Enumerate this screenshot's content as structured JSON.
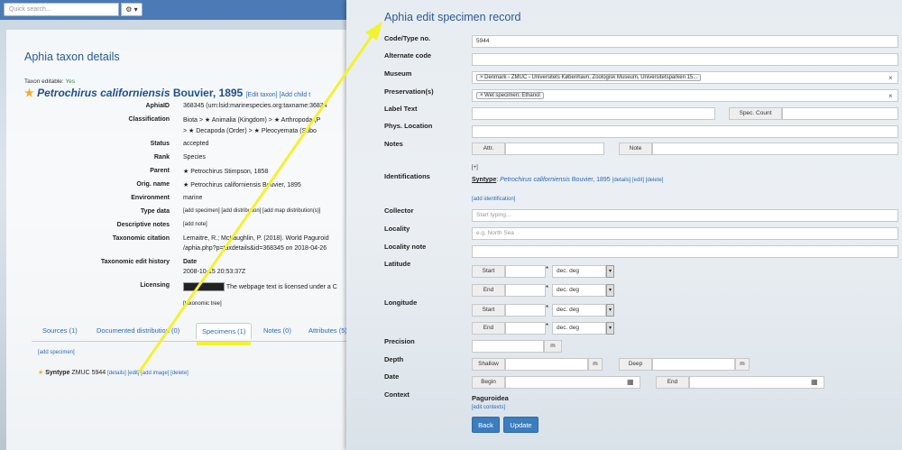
{
  "left": {
    "search_placeholder": "Quick search...",
    "gear": "⚙ ▾",
    "title": "Aphia taxon details",
    "editable_label": "Taxon editable:",
    "editable_value": "Yes",
    "taxon_name": "Petrochirus californiensis",
    "taxon_author": "Bouvier, 1895",
    "taxon_actions": "[Edit taxon] [Add child t",
    "rows": {
      "aphiaid_k": "AphiaID",
      "aphiaid_v": "368345  (urn:lsid:marinespecies.org:taxname:36834",
      "class_k": "Classification",
      "class_v1": "Biota  >  ★ Animalia (Kingdom)  >  ★ Arthropoda (P",
      "class_v2": ">  ★ Decapoda (Order)  >  ★ Pleocyemata (Subo",
      "status_k": "Status",
      "status_v": "accepted",
      "rank_k": "Rank",
      "rank_v": "Species",
      "parent_k": "Parent",
      "parent_v": "★ Petrochirus Stimpson, 1858",
      "orig_k": "Orig. name",
      "orig_v": "★ Petrochirus californiensis Bouvier, 1895",
      "env_k": "Environment",
      "env_v": "marine",
      "type_k": "Type data",
      "type_v": "[add specimen] [add distribution] [add map distribution(s)]",
      "desc_k": "Descriptive notes",
      "desc_v": "[add note]",
      "cit_k": "Taxonomic citation",
      "cit_v1": "Lemaitre, R.; McLaughlin, P. (2018). World Paguroid",
      "cit_v2": "/aphia.php?p=taxdetails&id=368345 on 2018-04-26",
      "hist_k": "Taxonomic edit history",
      "hist_v": "Date",
      "hist_date": "2008-10-15 20:53:37Z",
      "lic_k": "Licensing",
      "lic_v": "The webpage text is licensed under a C",
      "tree": "[taxonomic tree]"
    },
    "tabs": [
      "Sources (1)",
      "Documented distribution (0)",
      "Specimens (1)",
      "Notes (0)",
      "Attributes (5)"
    ],
    "add_specimen": "[add specimen]",
    "syntype_label": "Syntype",
    "syntype_text": "ZMUC 5944",
    "syntype_links": "[details] [edit] [add image] [delete]"
  },
  "modal": {
    "title": "Aphia edit specimen record",
    "labels": {
      "code": "Code/Type no.",
      "alt": "Alternate code",
      "museum": "Museum",
      "pres": "Preservation(s)",
      "label_text": "Label Text",
      "phys": "Phys. Location",
      "notes": "Notes",
      "ident": "Identifications",
      "collector": "Collector",
      "locality": "Locality",
      "locality_note": "Locality note",
      "latitude": "Latitude",
      "longitude": "Longitude",
      "precision": "Precision",
      "depth": "Depth",
      "date": "Date",
      "context": "Context"
    },
    "code_value": "5944",
    "museum_value": "× Denmark - ZMUC - Universitets København, Zoologisk Museum, Universitetsparken 15...",
    "pres_value": "× Wet specimen: Ethanol",
    "clear_x": "×",
    "spec_count": "Spec. Count",
    "attr": "Attr.",
    "note": "Note",
    "toggle": "[+]",
    "ident_type": "Syntype",
    "ident_name": "Petrochirus californiensis",
    "ident_author": "Bouvier, 1895",
    "ident_links": "[details] [edit] [delete]",
    "add_ident": "[add identification]",
    "collector_ph": "Start typing...",
    "locality_ph": "e.g. North Sea",
    "start": "Start",
    "end": "End",
    "unit_deg": "dec. deg",
    "caret": "▾",
    "m": "m",
    "shallow": "Shallow",
    "deep": "Deep",
    "begin": "Begin",
    "end_date": "End",
    "cal_icon": "▦",
    "context_value": "Paguroidea",
    "edit_contexts": "[edit contexts]",
    "back": "Back",
    "update": "Update"
  },
  "colors": {
    "accent": "#3b7dbf",
    "title": "#2a5a92",
    "arrow": "#f2f230",
    "star": "#f0ad2e"
  }
}
